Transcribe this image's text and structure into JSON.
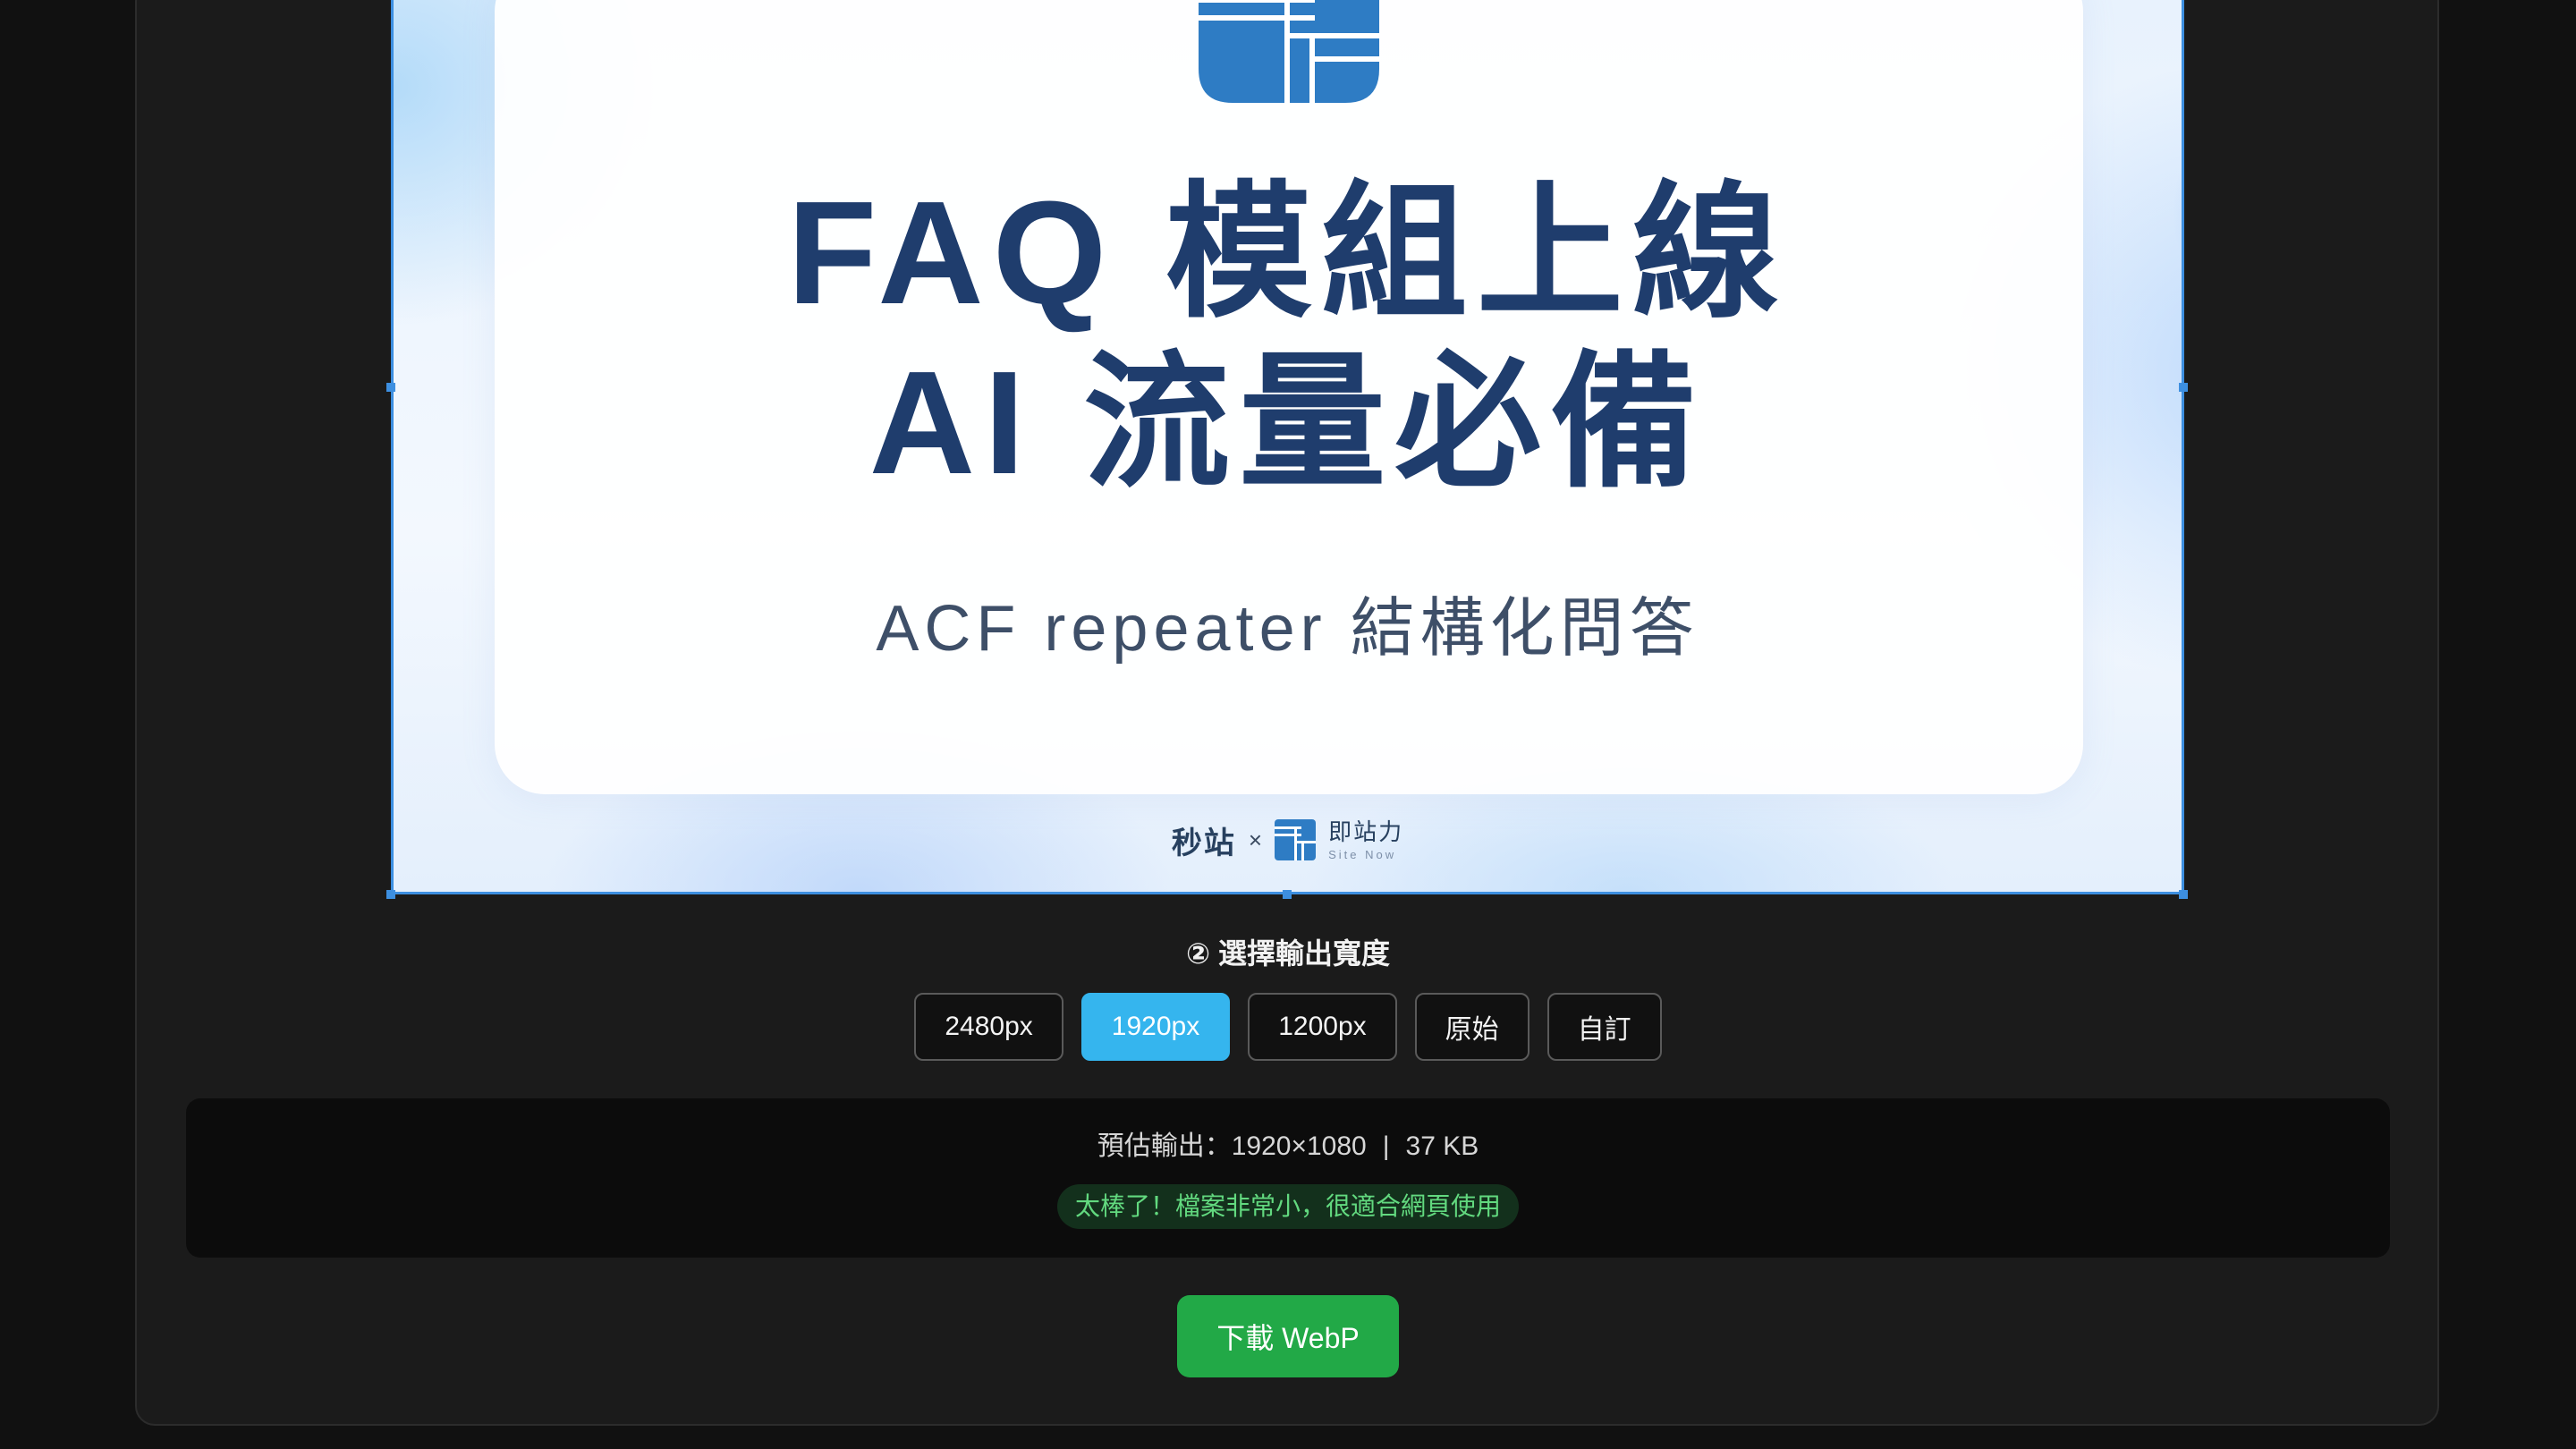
{
  "preview": {
    "title_line1": "FAQ 模組上線",
    "title_line2": "AI 流量必備",
    "subtitle": "ACF repeater 結構化問答",
    "brand_left": "秒站",
    "brand_separator": "×",
    "brand_right_name": "即站力",
    "brand_right_en": "Site Now",
    "logo_icon": "site-now-logo-icon",
    "accent_color": "#2e7cc4",
    "title_color": "#1f3d6d"
  },
  "width_selector": {
    "title": "② 選擇輸出寬度",
    "options": [
      {
        "label": "2480px",
        "active": false
      },
      {
        "label": "1920px",
        "active": true
      },
      {
        "label": "1200px",
        "active": false
      },
      {
        "label": "原始",
        "active": false
      },
      {
        "label": "自訂",
        "active": false
      }
    ],
    "active_color": "#35b5ee"
  },
  "estimate": {
    "prefix": "預估輸出：",
    "dimensions": "1920×1080",
    "separator": "|",
    "size": "37 KB",
    "message": "太棒了！檔案非常小，很適合網頁使用",
    "message_color": "#62d97f"
  },
  "download": {
    "label": "下載 WebP",
    "color": "#22a947"
  }
}
